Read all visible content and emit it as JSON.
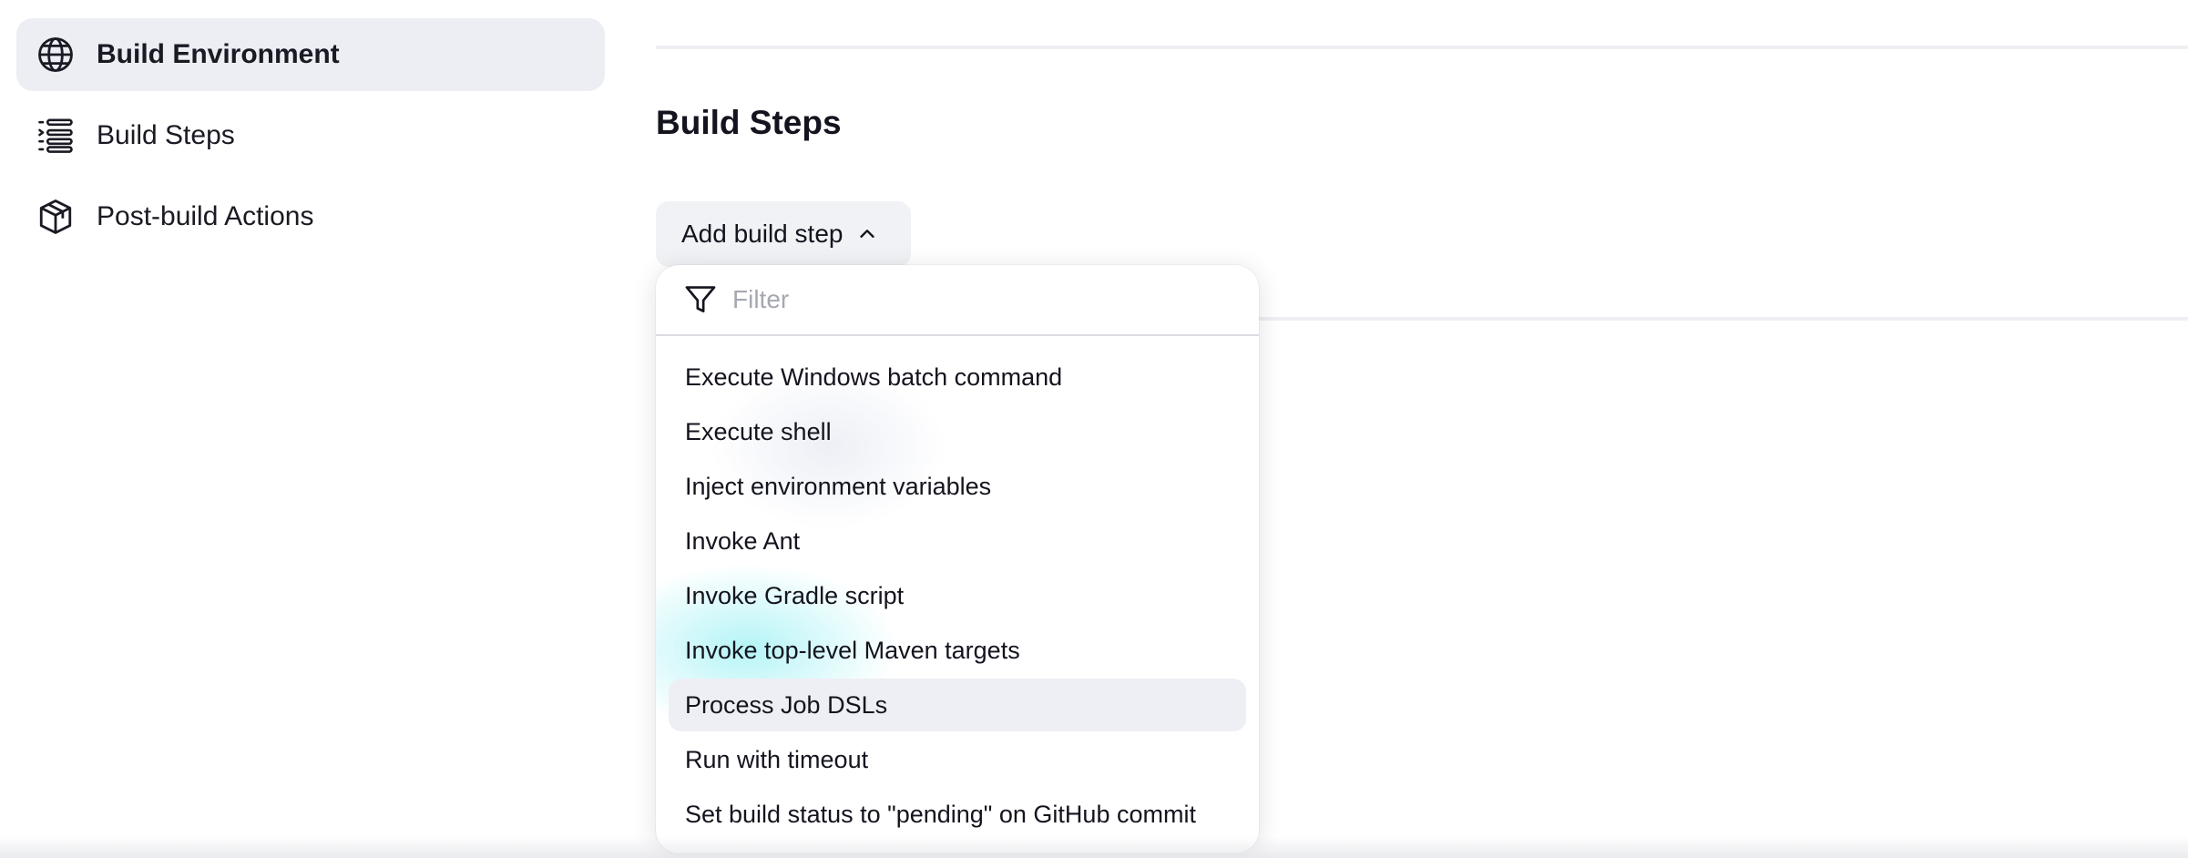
{
  "sidebar": {
    "items": [
      {
        "label": "Build Environment",
        "icon": "globe-icon",
        "active": true
      },
      {
        "label": "Build Steps",
        "icon": "list-steps-icon",
        "active": false
      },
      {
        "label": "Post-build Actions",
        "icon": "package-icon",
        "active": false
      }
    ]
  },
  "main": {
    "section_title": "Build Steps",
    "add_button_label": "Add build step"
  },
  "dropdown": {
    "filter_placeholder": "Filter",
    "items": [
      "Execute Windows batch command",
      "Execute shell",
      "Inject environment variables",
      "Invoke Ant",
      "Invoke Gradle script",
      "Invoke top-level Maven targets",
      "Process Job DSLs",
      "Run with timeout",
      "Set build status to \"pending\" on GitHub commit"
    ],
    "hovered_index": 6
  },
  "colors": {
    "active_bg": "#eceef3",
    "hover_bg": "#eeeff4",
    "text": "#14141f",
    "placeholder": "#a6a8b0"
  }
}
